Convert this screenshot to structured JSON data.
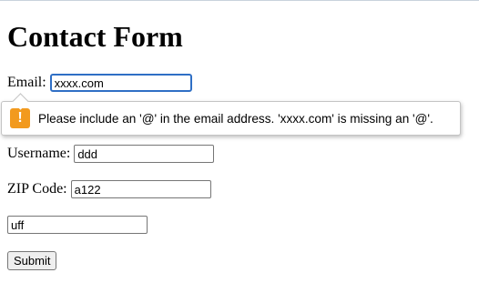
{
  "form": {
    "title": "Contact Form",
    "email": {
      "label": "Email:",
      "value": "xxxx.com"
    },
    "username": {
      "label": "Username:",
      "value": "ddd"
    },
    "zip": {
      "label": "ZIP Code:",
      "value": "a122"
    },
    "extra": {
      "value": "uff"
    },
    "submit_label": "Submit"
  },
  "validation_tooltip": {
    "icon": "warning-icon",
    "icon_glyph": "!",
    "icon_color": "#f29a1e",
    "message": "Please include an '@' in the email address. 'xxxx.com' is missing an '@'."
  },
  "colors": {
    "focus_ring": "#2f6fc5"
  }
}
